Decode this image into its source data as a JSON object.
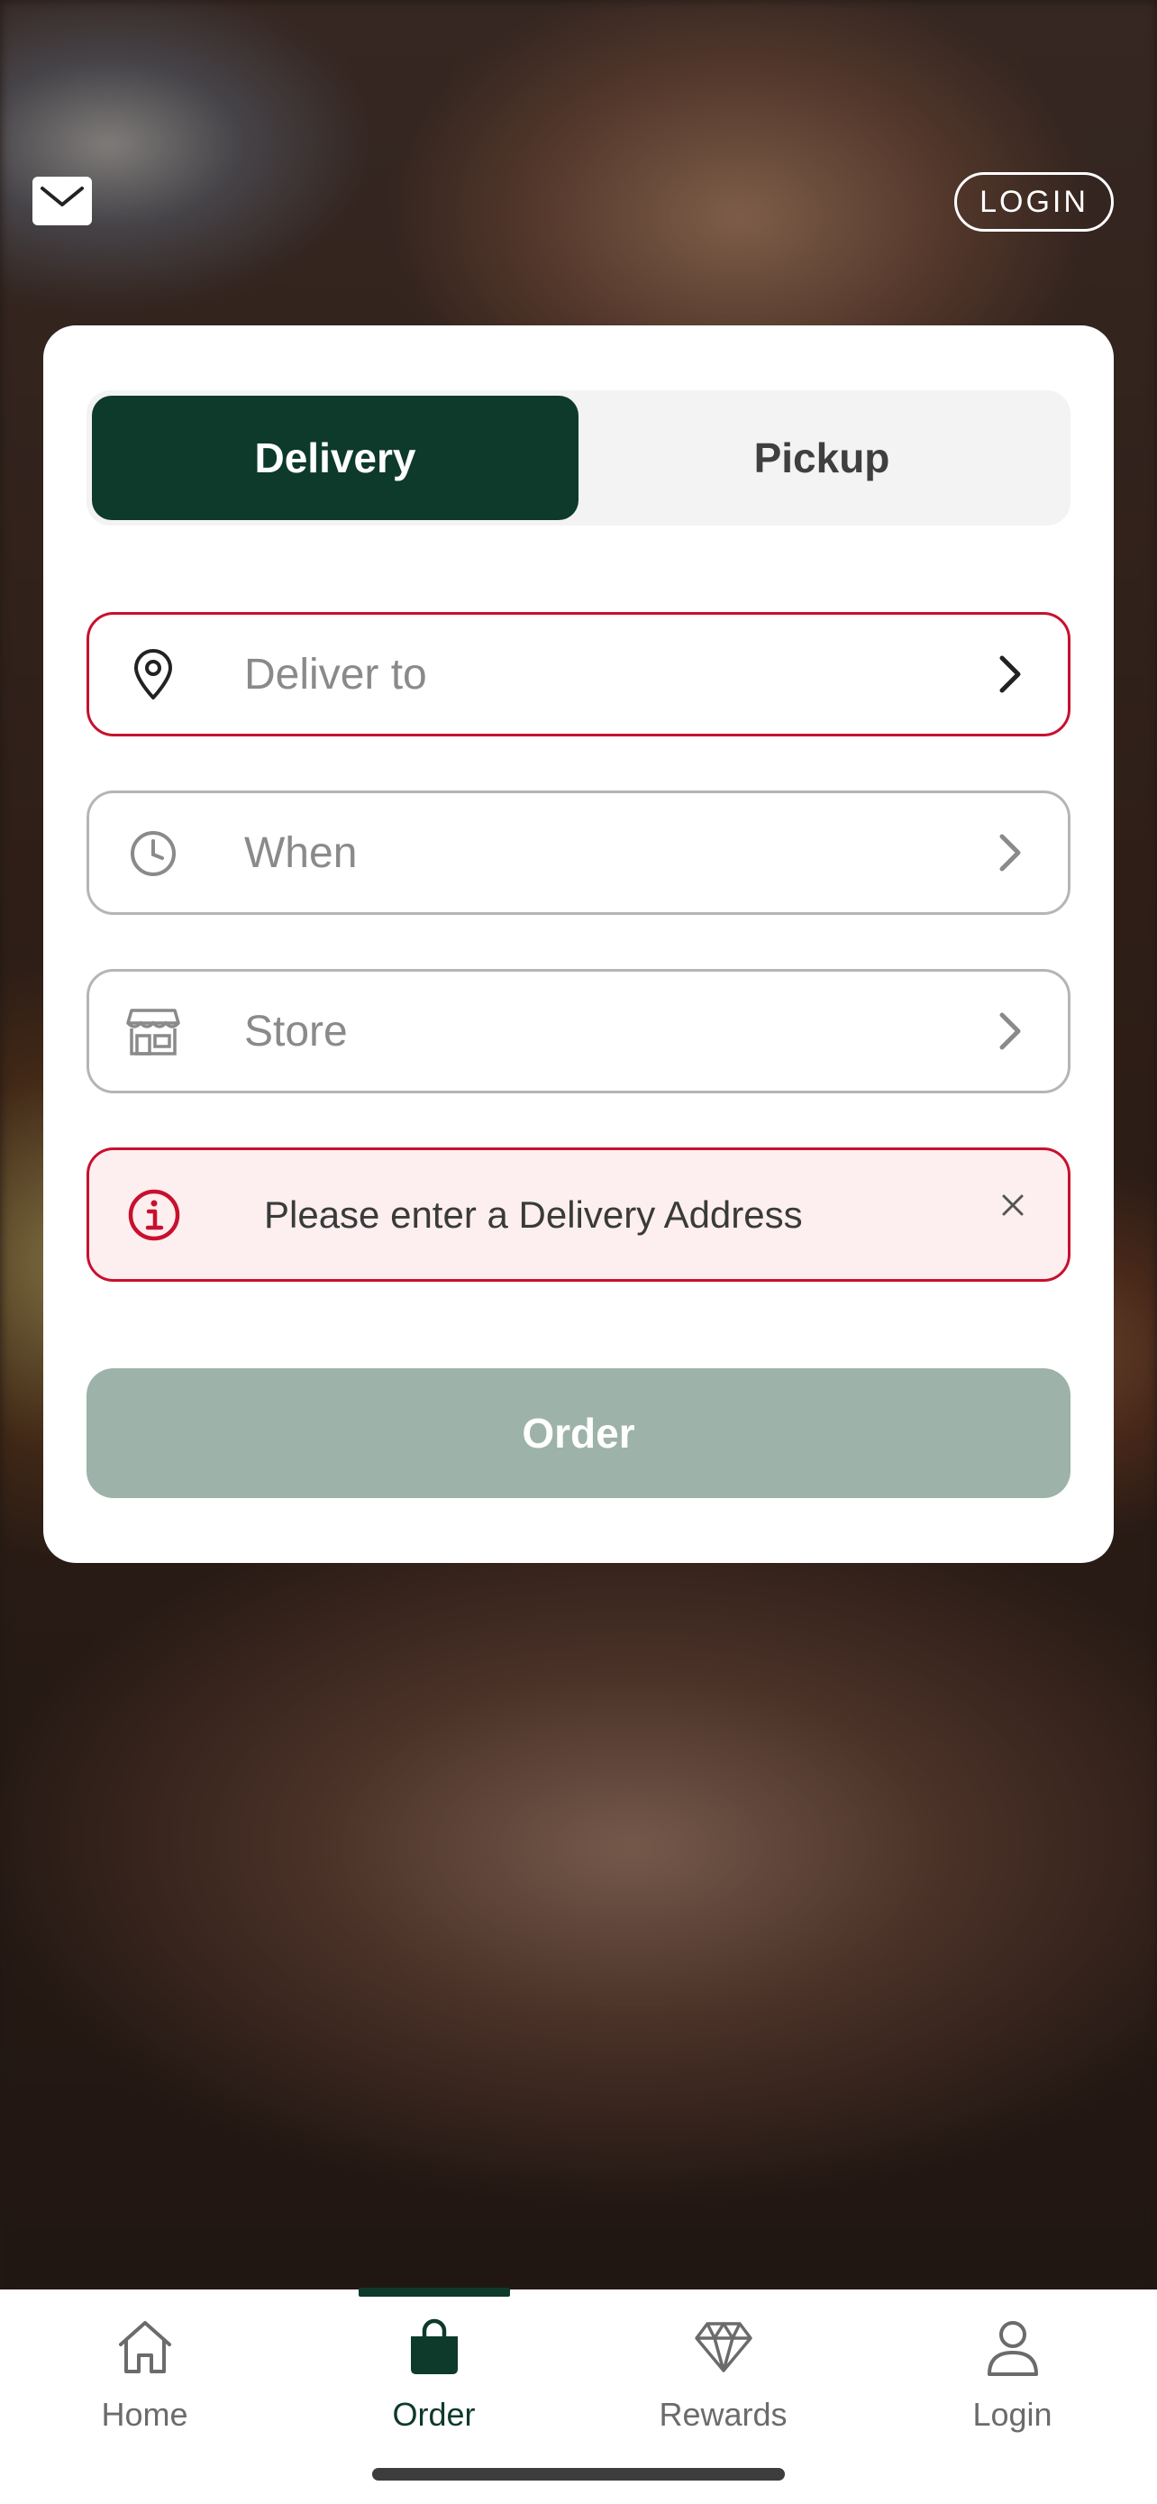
{
  "header": {
    "mail_icon": "envelope-icon",
    "login_label": "LOGIN"
  },
  "order_card": {
    "mode_tabs": [
      {
        "label": "Delivery",
        "selected": true
      },
      {
        "label": "Pickup",
        "selected": false
      }
    ],
    "fields": [
      {
        "icon": "location-pin-icon",
        "placeholder": "Deliver to",
        "state": "error"
      },
      {
        "icon": "clock-icon",
        "placeholder": "When",
        "state": "normal"
      },
      {
        "icon": "storefront-icon",
        "placeholder": "Store",
        "state": "normal"
      }
    ],
    "alert": {
      "icon": "info-icon",
      "message": "Please enter a Delivery Address",
      "close_icon": "close-icon"
    },
    "order_button_label": "Order"
  },
  "tab_bar": {
    "items": [
      {
        "label": "Home",
        "icon": "home-icon",
        "active": false
      },
      {
        "label": "Order",
        "icon": "shopping-bag-icon",
        "active": true
      },
      {
        "label": "Rewards",
        "icon": "diamond-icon",
        "active": false
      },
      {
        "label": "Login",
        "icon": "user-icon",
        "active": false
      }
    ]
  },
  "colors": {
    "brand_green": "#0d3a2a",
    "error_red": "#c8102e",
    "disabled_button": "#9db2a9",
    "alert_background": "#fdefef"
  }
}
